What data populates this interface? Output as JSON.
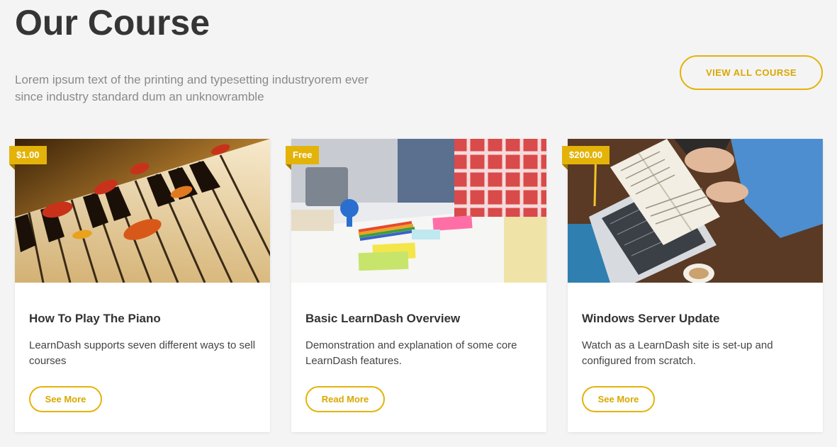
{
  "section": {
    "title": "Our Course",
    "intro": "Lorem ipsum text of the printing and typesetting industryorem ever since industry standard dum an unknowramble",
    "view_all_label": "VIEW ALL COURSE"
  },
  "courses": [
    {
      "price": "$1.00",
      "title": "How To Play The Piano",
      "description": "LearnDash supports seven different ways to sell courses",
      "button_label": "See More",
      "image": "piano-keys-with-flower-petals"
    },
    {
      "price": "Free",
      "title": "Basic LearnDash Overview",
      "description": "Demonstration and explanation of some core LearnDash features.",
      "button_label": "Read More",
      "image": "students-studying-with-sticky-notes"
    },
    {
      "price": "$200.00",
      "title": "Windows Server Update",
      "description": "Watch as a LearnDash site is set-up and configured from scratch.",
      "button_label": "See More",
      "image": "person-reading-book-on-laptop"
    }
  ],
  "colors": {
    "accent": "#e4b309",
    "title": "#353535",
    "muted": "#8a8a8a",
    "background": "#f4f4f4"
  }
}
